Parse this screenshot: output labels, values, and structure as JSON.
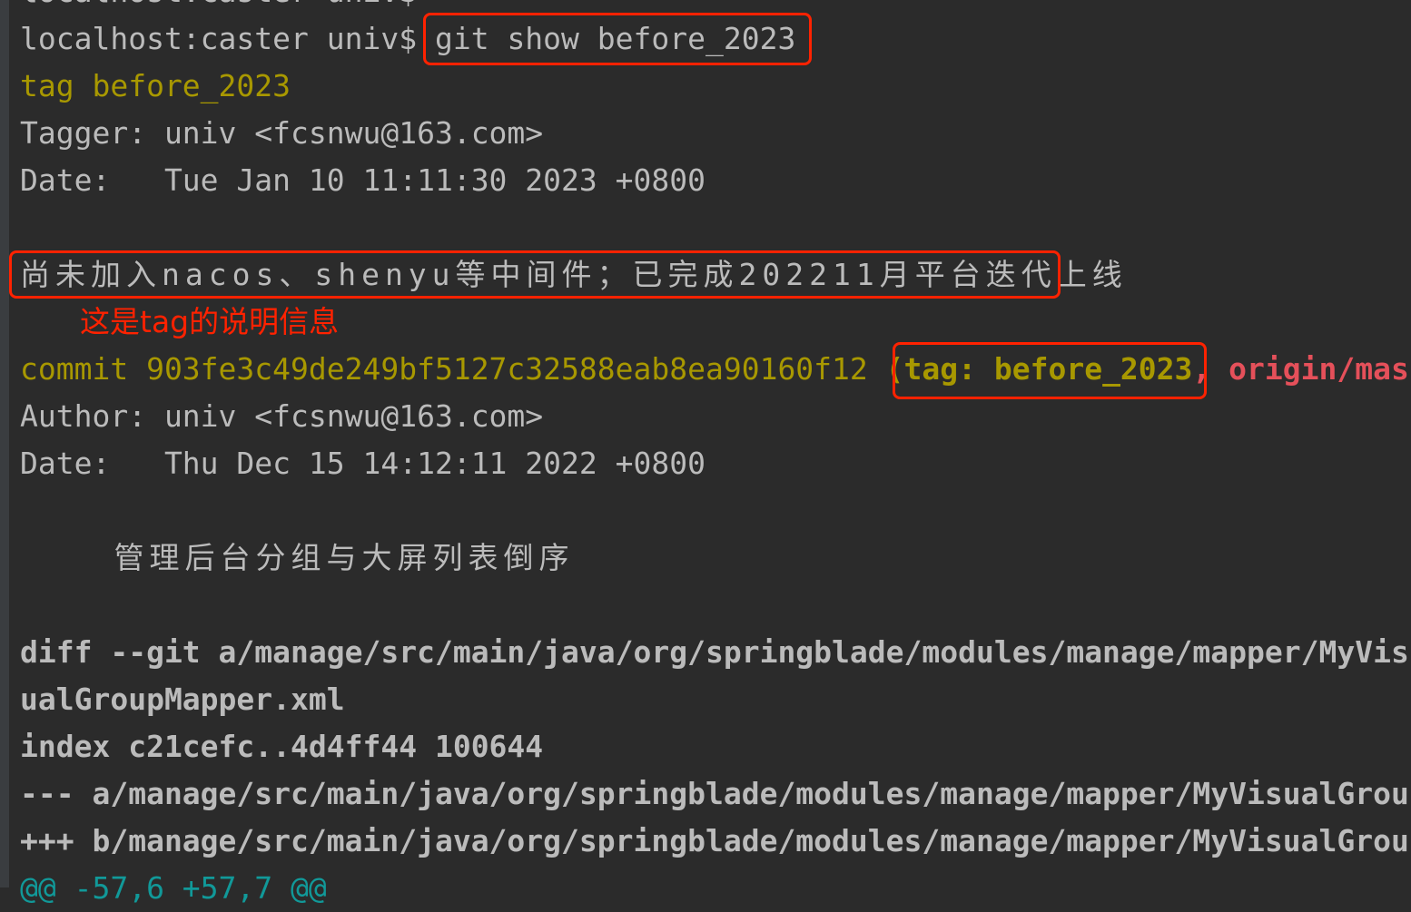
{
  "terminal": {
    "prev_prompt": "localhost:caster univ$",
    "prompt": "localhost:caster univ$ ",
    "command": "git show before_2023",
    "tag_line": "tag before_2023",
    "tagger": "Tagger: univ <fcsnwu@163.com>",
    "tag_date": "Date:   Tue Jan 10 11:11:30 2023 +0800",
    "tag_message": "尚未加入nacos、shenyu等中间件；已完成202211月平台迭代上线",
    "annotation": "这是tag的说明信息",
    "commit_prefix": "commit 903fe3c49de249bf5127c32588eab8ea90160f12 ",
    "commit_refs_tag": "(tag: before_2023",
    "commit_refs_rest": ", origin/mas",
    "author": "Author: univ <fcsnwu@163.com>",
    "commit_date": "Date:   Thu Dec 15 14:12:11 2022 +0800",
    "commit_message": "    管理后台分组与大屏列表倒序",
    "diff_line1": "diff --git a/manage/src/main/java/org/springblade/modules/manage/mapper/MyVis",
    "diff_line2": "ualGroupMapper.xml",
    "index_line": "index c21cefc..4d4ff44 100644",
    "minus_line": "--- a/manage/src/main/java/org/springblade/modules/manage/mapper/MyVisualGrou",
    "plus_line": "+++ b/manage/src/main/java/org/springblade/modules/manage/mapper/MyVisualGrou",
    "hunk_line": "@@ -57,6 +57,7 @@"
  },
  "colors": {
    "background": "#2b2b2b",
    "text": "#bbbbbb",
    "yellow": "#a89800",
    "red": "#e5505a",
    "cyan": "#119999",
    "annotation": "#ff2200"
  }
}
